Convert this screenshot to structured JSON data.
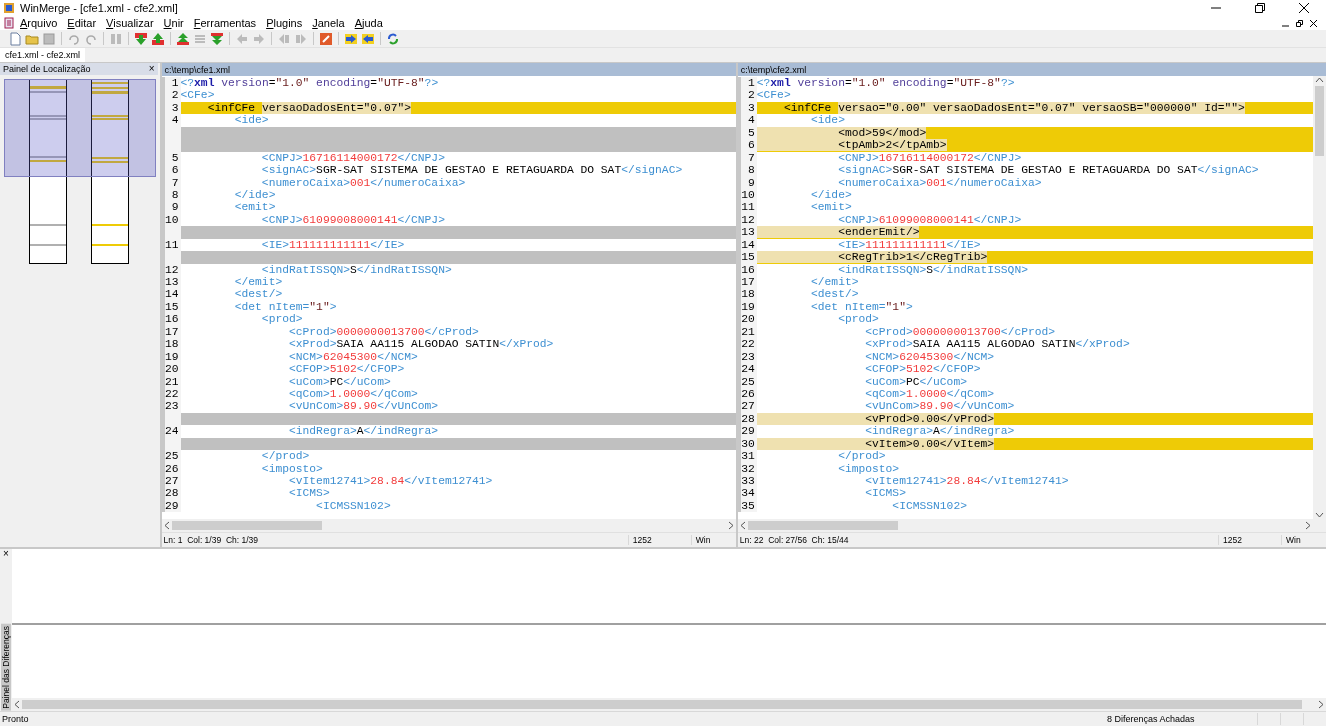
{
  "window": {
    "title": "WinMerge - [cfe1.xml - cfe2.xml]"
  },
  "menu": [
    "Arquivo",
    "Editar",
    "Visualizar",
    "Unir",
    "Ferramentas",
    "Plugins",
    "Janela",
    "Ajuda"
  ],
  "document_tab": {
    "label": "cfe1.xml - cfe2.xml"
  },
  "location_panel": {
    "title": "Painel de Localização",
    "close": "×"
  },
  "panes": [
    {
      "path": "c:\\temp\\cfe1.xml",
      "status": {
        "position": "Ln: 1  Col: 1/39  Ch: 1/39",
        "codepage": "1252",
        "eol": "Win"
      },
      "lines": [
        {
          "n": "1",
          "kind": "same",
          "tokens": [
            {
              "kind": "tag",
              "text": "<?"
            },
            {
              "kind": "keyword",
              "text": "xml"
            },
            {
              "kind": "attr",
              "text": " version"
            },
            {
              "kind": "text",
              "text": "="
            },
            {
              "kind": "string",
              "text": "\"1.0\""
            },
            {
              "kind": "attr",
              "text": " encoding"
            },
            {
              "kind": "text",
              "text": "="
            },
            {
              "kind": "string",
              "text": "\"UTF-8\""
            },
            {
              "kind": "tag",
              "text": "?>"
            }
          ]
        },
        {
          "n": "2",
          "kind": "same",
          "tokens": [
            {
              "kind": "tag",
              "text": "<CFe>"
            }
          ]
        },
        {
          "n": "3",
          "kind": "diff",
          "tokens": [
            {
              "text": "    <infCFe ",
              "changed": false
            },
            {
              "text": "versaoDadosEnt=\"0.07\">",
              "changed": true
            }
          ]
        },
        {
          "n": "4",
          "kind": "same",
          "tokens": [
            {
              "kind": "tag",
              "text": "        <ide>"
            }
          ]
        },
        {
          "kind": "gap"
        },
        {
          "kind": "gap"
        },
        {
          "n": "5",
          "kind": "same",
          "tokens": [
            {
              "kind": "tag",
              "text": "            <CNPJ>"
            },
            {
              "kind": "value",
              "text": "16716114000172"
            },
            {
              "kind": "tag",
              "text": "</CNPJ>"
            }
          ]
        },
        {
          "n": "6",
          "kind": "same",
          "tokens": [
            {
              "kind": "tag",
              "text": "            <signAC>"
            },
            {
              "kind": "text",
              "text": "SGR-SAT SISTEMA DE GESTAO E RETAGUARDA DO SAT"
            },
            {
              "kind": "tag",
              "text": "</signAC>"
            }
          ]
        },
        {
          "n": "7",
          "kind": "same",
          "tokens": [
            {
              "kind": "tag",
              "text": "            <numeroCaixa>"
            },
            {
              "kind": "value",
              "text": "001"
            },
            {
              "kind": "tag",
              "text": "</numeroCaixa>"
            }
          ]
        },
        {
          "n": "8",
          "kind": "same",
          "tokens": [
            {
              "kind": "tag",
              "text": "        </ide>"
            }
          ]
        },
        {
          "n": "9",
          "kind": "same",
          "tokens": [
            {
              "kind": "tag",
              "text": "        <emit>"
            }
          ]
        },
        {
          "n": "10",
          "kind": "same",
          "tokens": [
            {
              "kind": "tag",
              "text": "            <CNPJ>"
            },
            {
              "kind": "value",
              "text": "61099008000141"
            },
            {
              "kind": "tag",
              "text": "</CNPJ>"
            }
          ]
        },
        {
          "kind": "gap"
        },
        {
          "n": "11",
          "kind": "same",
          "tokens": [
            {
              "kind": "tag",
              "text": "            <IE>"
            },
            {
              "kind": "value",
              "text": "111111111111"
            },
            {
              "kind": "tag",
              "text": "</IE>"
            }
          ]
        },
        {
          "kind": "gap"
        },
        {
          "n": "12",
          "kind": "same",
          "tokens": [
            {
              "kind": "tag",
              "text": "            <indRatISSQN>"
            },
            {
              "kind": "text",
              "text": "S"
            },
            {
              "kind": "tag",
              "text": "</indRatISSQN>"
            }
          ]
        },
        {
          "n": "13",
          "kind": "same",
          "tokens": [
            {
              "kind": "tag",
              "text": "        </emit>"
            }
          ]
        },
        {
          "n": "14",
          "kind": "same",
          "tokens": [
            {
              "kind": "tag",
              "text": "        <dest/>"
            }
          ]
        },
        {
          "n": "15",
          "kind": "same",
          "tokens": [
            {
              "kind": "tag",
              "text": "        <det nItem="
            },
            {
              "kind": "string",
              "text": "\"1\""
            },
            {
              "kind": "tag",
              "text": ">"
            }
          ]
        },
        {
          "n": "16",
          "kind": "same",
          "tokens": [
            {
              "kind": "tag",
              "text": "            <prod>"
            }
          ]
        },
        {
          "n": "17",
          "kind": "same",
          "tokens": [
            {
              "kind": "tag",
              "text": "                <cProd>"
            },
            {
              "kind": "value",
              "text": "0000000013700"
            },
            {
              "kind": "tag",
              "text": "</cProd>"
            }
          ]
        },
        {
          "n": "18",
          "kind": "same",
          "tokens": [
            {
              "kind": "tag",
              "text": "                <xProd>"
            },
            {
              "kind": "text",
              "text": "SAIA AA115 ALGODAO SATIN"
            },
            {
              "kind": "tag",
              "text": "</xProd>"
            }
          ]
        },
        {
          "n": "19",
          "kind": "same",
          "tokens": [
            {
              "kind": "tag",
              "text": "                <NCM>"
            },
            {
              "kind": "value",
              "text": "62045300"
            },
            {
              "kind": "tag",
              "text": "</NCM>"
            }
          ]
        },
        {
          "n": "20",
          "kind": "same",
          "tokens": [
            {
              "kind": "tag",
              "text": "                <CFOP>"
            },
            {
              "kind": "value",
              "text": "5102"
            },
            {
              "kind": "tag",
              "text": "</CFOP>"
            }
          ]
        },
        {
          "n": "21",
          "kind": "same",
          "tokens": [
            {
              "kind": "tag",
              "text": "                <uCom>"
            },
            {
              "kind": "text",
              "text": "PC"
            },
            {
              "kind": "tag",
              "text": "</uCom>"
            }
          ]
        },
        {
          "n": "22",
          "kind": "same",
          "tokens": [
            {
              "kind": "tag",
              "text": "                <qCom>"
            },
            {
              "kind": "value",
              "text": "1.0000"
            },
            {
              "kind": "tag",
              "text": "</qCom>"
            }
          ]
        },
        {
          "n": "23",
          "kind": "same",
          "tokens": [
            {
              "kind": "tag",
              "text": "                <vUnCom>"
            },
            {
              "kind": "value",
              "text": "89.90"
            },
            {
              "kind": "tag",
              "text": "</vUnCom>"
            }
          ]
        },
        {
          "kind": "gap"
        },
        {
          "n": "24",
          "kind": "same",
          "tokens": [
            {
              "kind": "tag",
              "text": "                <indRegra>"
            },
            {
              "kind": "text",
              "text": "A"
            },
            {
              "kind": "tag",
              "text": "</indRegra>"
            }
          ]
        },
        {
          "kind": "gap"
        },
        {
          "n": "25",
          "kind": "same",
          "tokens": [
            {
              "kind": "tag",
              "text": "            </prod>"
            }
          ]
        },
        {
          "n": "26",
          "kind": "same",
          "tokens": [
            {
              "kind": "tag",
              "text": "            <imposto>"
            }
          ]
        },
        {
          "n": "27",
          "kind": "same",
          "tokens": [
            {
              "kind": "tag",
              "text": "                <vItem12741>"
            },
            {
              "kind": "value",
              "text": "28.84"
            },
            {
              "kind": "tag",
              "text": "</vItem12741>"
            }
          ]
        },
        {
          "n": "28",
          "kind": "same",
          "tokens": [
            {
              "kind": "tag",
              "text": "                <ICMS>"
            }
          ]
        },
        {
          "n": "29",
          "kind": "same",
          "tokens": [
            {
              "kind": "tag",
              "text": "                    <ICMSSN102>"
            }
          ]
        }
      ]
    },
    {
      "path": "c:\\temp\\cfe2.xml",
      "status": {
        "position": "Ln: 22  Col: 27/56  Ch: 15/44",
        "codepage": "1252",
        "eol": "Win"
      },
      "lines": [
        {
          "n": "1",
          "kind": "same",
          "tokens": [
            {
              "kind": "tag",
              "text": "<?"
            },
            {
              "kind": "keyword",
              "text": "xml"
            },
            {
              "kind": "attr",
              "text": " version"
            },
            {
              "kind": "text",
              "text": "="
            },
            {
              "kind": "string",
              "text": "\"1.0\""
            },
            {
              "kind": "attr",
              "text": " encoding"
            },
            {
              "kind": "text",
              "text": "="
            },
            {
              "kind": "string",
              "text": "\"UTF-8\""
            },
            {
              "kind": "tag",
              "text": "?>"
            }
          ]
        },
        {
          "n": "2",
          "kind": "same",
          "tokens": [
            {
              "kind": "tag",
              "text": "<CFe>"
            }
          ]
        },
        {
          "n": "3",
          "kind": "diff",
          "tokens": [
            {
              "text": "    <infCFe ",
              "changed": false
            },
            {
              "text": "versao=\"0.00\" versaoDadosEnt=\"0.07\" versaoSB=\"000000\" Id=\"\">",
              "changed": true
            }
          ]
        },
        {
          "n": "4",
          "kind": "same",
          "tokens": [
            {
              "kind": "tag",
              "text": "        <ide>"
            }
          ]
        },
        {
          "n": "5",
          "kind": "diff",
          "tokens": [
            {
              "text": "            <mod>59</mod>",
              "changed": true
            }
          ]
        },
        {
          "n": "6",
          "kind": "diff",
          "tokens": [
            {
              "text": "            <tpAmb>2</tpAmb>",
              "changed": true
            }
          ]
        },
        {
          "n": "7",
          "kind": "same",
          "tokens": [
            {
              "kind": "tag",
              "text": "            <CNPJ>"
            },
            {
              "kind": "value",
              "text": "16716114000172"
            },
            {
              "kind": "tag",
              "text": "</CNPJ>"
            }
          ]
        },
        {
          "n": "8",
          "kind": "same",
          "tokens": [
            {
              "kind": "tag",
              "text": "            <signAC>"
            },
            {
              "kind": "text",
              "text": "SGR-SAT SISTEMA DE GESTAO E RETAGUARDA DO SAT"
            },
            {
              "kind": "tag",
              "text": "</signAC>"
            }
          ]
        },
        {
          "n": "9",
          "kind": "same",
          "tokens": [
            {
              "kind": "tag",
              "text": "            <numeroCaixa>"
            },
            {
              "kind": "value",
              "text": "001"
            },
            {
              "kind": "tag",
              "text": "</numeroCaixa>"
            }
          ]
        },
        {
          "n": "10",
          "kind": "same",
          "tokens": [
            {
              "kind": "tag",
              "text": "        </ide>"
            }
          ]
        },
        {
          "n": "11",
          "kind": "same",
          "tokens": [
            {
              "kind": "tag",
              "text": "        <emit>"
            }
          ]
        },
        {
          "n": "12",
          "kind": "same",
          "tokens": [
            {
              "kind": "tag",
              "text": "            <CNPJ>"
            },
            {
              "kind": "value",
              "text": "61099008000141"
            },
            {
              "kind": "tag",
              "text": "</CNPJ>"
            }
          ]
        },
        {
          "n": "13",
          "kind": "diff",
          "tokens": [
            {
              "text": "            <enderEmit/>",
              "changed": true
            }
          ]
        },
        {
          "n": "14",
          "kind": "same",
          "tokens": [
            {
              "kind": "tag",
              "text": "            <IE>"
            },
            {
              "kind": "value",
              "text": "111111111111"
            },
            {
              "kind": "tag",
              "text": "</IE>"
            }
          ]
        },
        {
          "n": "15",
          "kind": "diff",
          "tokens": [
            {
              "text": "            <cRegTrib>1</cRegTrib>",
              "changed": true
            }
          ]
        },
        {
          "n": "16",
          "kind": "same",
          "tokens": [
            {
              "kind": "tag",
              "text": "            <indRatISSQN>"
            },
            {
              "kind": "text",
              "text": "S"
            },
            {
              "kind": "tag",
              "text": "</indRatISSQN>"
            }
          ]
        },
        {
          "n": "17",
          "kind": "same",
          "tokens": [
            {
              "kind": "tag",
              "text": "        </emit>"
            }
          ]
        },
        {
          "n": "18",
          "kind": "same",
          "tokens": [
            {
              "kind": "tag",
              "text": "        <dest/>"
            }
          ]
        },
        {
          "n": "19",
          "kind": "same",
          "tokens": [
            {
              "kind": "tag",
              "text": "        <det nItem="
            },
            {
              "kind": "string",
              "text": "\"1\""
            },
            {
              "kind": "tag",
              "text": ">"
            }
          ]
        },
        {
          "n": "20",
          "kind": "same",
          "tokens": [
            {
              "kind": "tag",
              "text": "            <prod>"
            }
          ]
        },
        {
          "n": "21",
          "kind": "same",
          "tokens": [
            {
              "kind": "tag",
              "text": "                <cProd>"
            },
            {
              "kind": "value",
              "text": "0000000013700"
            },
            {
              "kind": "tag",
              "text": "</cProd>"
            }
          ]
        },
        {
          "n": "22",
          "kind": "same",
          "tokens": [
            {
              "kind": "tag",
              "text": "                <xProd>"
            },
            {
              "kind": "text",
              "text": "SAIA AA115 ALGODAO SATIN"
            },
            {
              "kind": "tag",
              "text": "</xProd>"
            }
          ]
        },
        {
          "n": "23",
          "kind": "same",
          "tokens": [
            {
              "kind": "tag",
              "text": "                <NCM>"
            },
            {
              "kind": "value",
              "text": "62045300"
            },
            {
              "kind": "tag",
              "text": "</NCM>"
            }
          ]
        },
        {
          "n": "24",
          "kind": "same",
          "tokens": [
            {
              "kind": "tag",
              "text": "                <CFOP>"
            },
            {
              "kind": "value",
              "text": "5102"
            },
            {
              "kind": "tag",
              "text": "</CFOP>"
            }
          ]
        },
        {
          "n": "25",
          "kind": "same",
          "tokens": [
            {
              "kind": "tag",
              "text": "                <uCom>"
            },
            {
              "kind": "text",
              "text": "PC"
            },
            {
              "kind": "tag",
              "text": "</uCom>"
            }
          ]
        },
        {
          "n": "26",
          "kind": "same",
          "tokens": [
            {
              "kind": "tag",
              "text": "                <qCom>"
            },
            {
              "kind": "value",
              "text": "1.0000"
            },
            {
              "kind": "tag",
              "text": "</qCom>"
            }
          ]
        },
        {
          "n": "27",
          "kind": "same",
          "tokens": [
            {
              "kind": "tag",
              "text": "                <vUnCom>"
            },
            {
              "kind": "value",
              "text": "89.90"
            },
            {
              "kind": "tag",
              "text": "</vUnCom>"
            }
          ]
        },
        {
          "n": "28",
          "kind": "diff",
          "tokens": [
            {
              "text": "                <vProd>0.00</vProd>",
              "changed": true
            }
          ]
        },
        {
          "n": "29",
          "kind": "same",
          "tokens": [
            {
              "kind": "tag",
              "text": "                <indRegra>"
            },
            {
              "kind": "text",
              "text": "A"
            },
            {
              "kind": "tag",
              "text": "</indRegra>"
            }
          ]
        },
        {
          "n": "30",
          "kind": "diff",
          "tokens": [
            {
              "text": "                <vItem>0.00</vItem>",
              "changed": true
            }
          ]
        },
        {
          "n": "31",
          "kind": "same",
          "tokens": [
            {
              "kind": "tag",
              "text": "            </prod>"
            }
          ]
        },
        {
          "n": "32",
          "kind": "same",
          "tokens": [
            {
              "kind": "tag",
              "text": "            <imposto>"
            }
          ]
        },
        {
          "n": "33",
          "kind": "same",
          "tokens": [
            {
              "kind": "tag",
              "text": "                <vItem12741>"
            },
            {
              "kind": "value",
              "text": "28.84"
            },
            {
              "kind": "tag",
              "text": "</vItem12741>"
            }
          ]
        },
        {
          "n": "34",
          "kind": "same",
          "tokens": [
            {
              "kind": "tag",
              "text": "                <ICMS>"
            }
          ]
        },
        {
          "n": "35",
          "kind": "same",
          "tokens": [
            {
              "kind": "tag",
              "text": "                    <ICMSSN102>"
            }
          ]
        }
      ]
    }
  ],
  "diff_panel": {
    "title": "Painel das Diferenças",
    "close": "×"
  },
  "status_bar": {
    "message": "Pronto",
    "differences": "8 Diferenças Achadas"
  }
}
